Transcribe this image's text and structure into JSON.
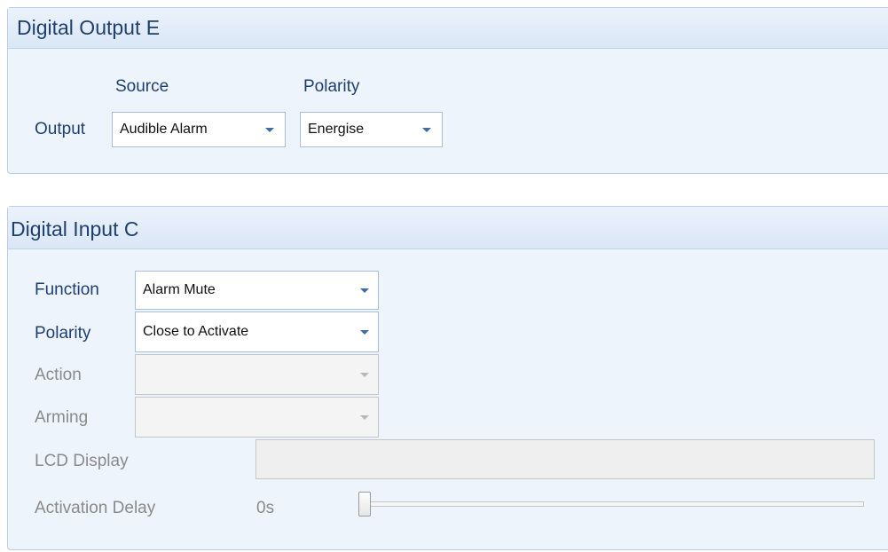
{
  "digital_output": {
    "title": "Digital Output E",
    "source_header": "Source",
    "polarity_header": "Polarity",
    "row_label": "Output",
    "source_value": "Audible Alarm",
    "polarity_value": "Energise"
  },
  "digital_input": {
    "title": "Digital Input C",
    "function_label": "Function",
    "function_value": "Alarm Mute",
    "polarity_label": "Polarity",
    "polarity_value": "Close to Activate",
    "action_label": "Action",
    "action_value": "",
    "arming_label": "Arming",
    "arming_value": "",
    "lcd_label": "LCD Display",
    "lcd_value": "",
    "delay_label": "Activation Delay",
    "delay_value": "0s",
    "delay_slider_level": 0
  },
  "colors": {
    "panel_bg": "#eef4fc",
    "header_bg": "#dae7f6",
    "title_text": "#1f3f6e",
    "label_text": "#1e3f73",
    "disabled_text": "#8a8a8a",
    "combo_arrow": "#3f6ca3"
  }
}
